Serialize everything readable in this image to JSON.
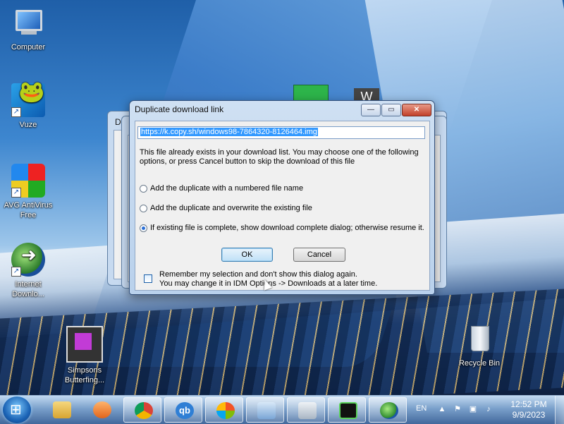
{
  "desktop": {
    "icons": [
      {
        "label": "Computer"
      },
      {
        "label": "Vuze"
      },
      {
        "label": "AVG AntiVirus Free"
      },
      {
        "label": "Internet Downlo..."
      },
      {
        "label": "Simpsons Butterfing..."
      },
      {
        "label": "Recycle Bin"
      }
    ],
    "peek_w": "W"
  },
  "background_dialogs": [
    {
      "title_initial": "D"
    },
    {
      "title_initial": "D"
    }
  ],
  "dialog": {
    "title": "Duplicate download link",
    "url": "https://k.copy.sh/windows98-7864320-8126464.img",
    "message": "This file already exists in your download list. You may choose one of the following options, or press Cancel button to skip the download of this file",
    "options": [
      {
        "label": "Add the duplicate with a numbered file name",
        "selected": false
      },
      {
        "label": "Add the duplicate and overwrite the existing file",
        "selected": false
      },
      {
        "label": "If existing file is complete, show download complete dialog; otherwise resume it.",
        "selected": true
      }
    ],
    "ok_label": "OK",
    "cancel_label": "Cancel",
    "remember_line1": "Remember my selection and don't show this dialog again.",
    "remember_line2": "You may change it in IDM Options -> Downloads at a later time.",
    "remember_checked": false,
    "caption_buttons": {
      "minimize": "—",
      "maximize": "▭",
      "close": "✕"
    }
  },
  "taskbar": {
    "start_icon": "windows-logo-icon",
    "apps": [
      {
        "name": "file-explorer-icon"
      },
      {
        "name": "media-player-icon"
      },
      {
        "name": "chrome-icon"
      },
      {
        "name": "qbittorrent-icon",
        "text": "qb"
      },
      {
        "name": "windows-media-icon"
      },
      {
        "name": "control-panel-icon"
      },
      {
        "name": "on-screen-keyboard-icon"
      },
      {
        "name": "game-icon"
      },
      {
        "name": "idm-icon"
      }
    ],
    "tray": {
      "language": "EN",
      "time": "12:52 PM",
      "date": "9/9/2023"
    }
  }
}
